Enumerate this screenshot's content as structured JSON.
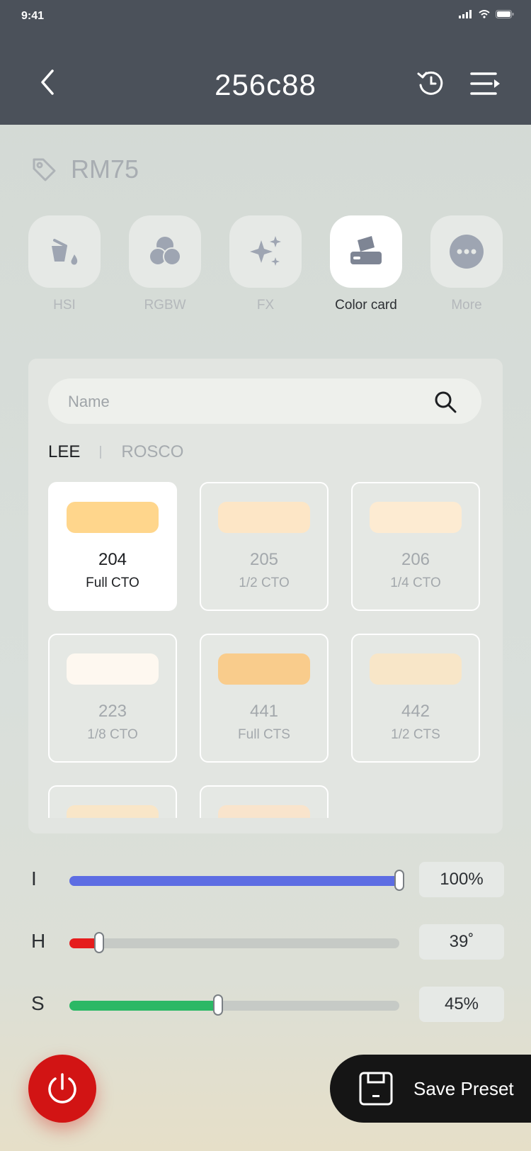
{
  "status_bar": {
    "time": "9:41"
  },
  "header": {
    "title": "256c88"
  },
  "device": {
    "name": "RM75"
  },
  "modes": [
    {
      "label": "HSI",
      "icon": "paint-bucket-icon",
      "active": false
    },
    {
      "label": "RGBW",
      "icon": "rgb-circles-icon",
      "active": false
    },
    {
      "label": "FX",
      "icon": "sparkle-icon",
      "active": false
    },
    {
      "label": "Color card",
      "icon": "color-card-icon",
      "active": true
    },
    {
      "label": "More",
      "icon": "more-icon",
      "active": false
    }
  ],
  "search": {
    "placeholder": "Name"
  },
  "brands": [
    {
      "label": "LEE",
      "active": true
    },
    {
      "label": "ROSCO",
      "active": false
    }
  ],
  "color_cards": [
    {
      "code": "204",
      "name": "Full CTO",
      "color": "#ffd68c",
      "active": true
    },
    {
      "code": "205",
      "name": "1/2 CTO",
      "color": "#fde6c6",
      "active": false
    },
    {
      "code": "206",
      "name": "1/4 CTO",
      "color": "#fdebd2",
      "active": false
    },
    {
      "code": "223",
      "name": "1/8 CTO",
      "color": "#fef8f0",
      "active": false
    },
    {
      "code": "441",
      "name": "Full CTS",
      "color": "#f9cc8c",
      "active": false
    },
    {
      "code": "442",
      "name": "1/2 CTS",
      "color": "#f8e6c8",
      "active": false
    },
    {
      "code": "",
      "name": "",
      "color": "#f9e6c8",
      "active": false
    },
    {
      "code": "",
      "name": "",
      "color": "#f9e4cc",
      "active": false
    }
  ],
  "sliders": [
    {
      "letter": "I",
      "value": "100%",
      "fraction": 1.0,
      "color": "#5d6de3"
    },
    {
      "letter": "H",
      "value": "39˚",
      "fraction": 0.09,
      "color": "#e51d1d"
    },
    {
      "letter": "S",
      "value": "45%",
      "fraction": 0.45,
      "color": "#2bb865"
    }
  ],
  "actions": {
    "save_label": "Save Preset"
  }
}
